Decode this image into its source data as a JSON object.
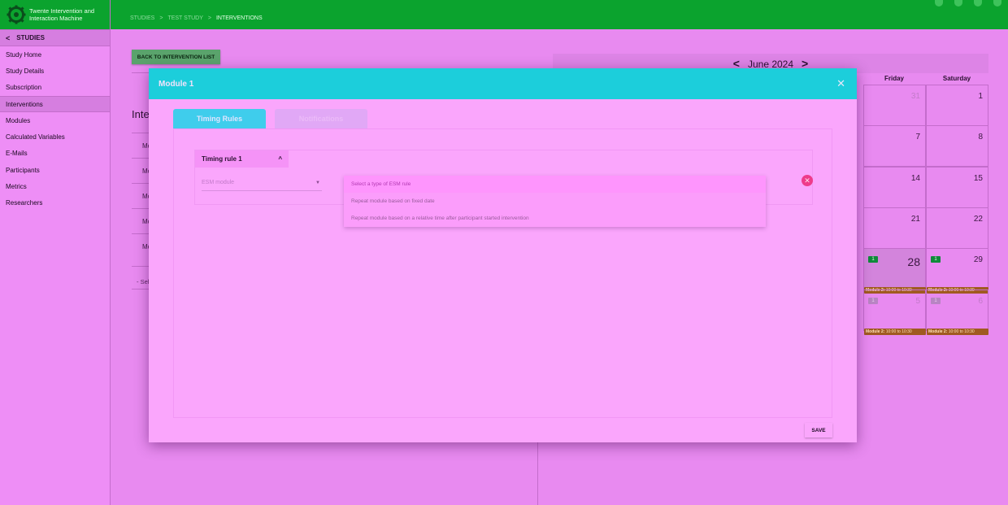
{
  "app": {
    "name": "Twente Intervention and Interaction Machine",
    "icon": "gear-logo"
  },
  "breadcrumbs": [
    "STUDIES",
    "TEST STUDY",
    "INTERVENTIONS"
  ],
  "breadcrumb_separator": ">",
  "top_icons": [
    "settings-icon",
    "shield-icon",
    "help-icon",
    "logout-icon"
  ],
  "sidebar": {
    "header": "STUDIES",
    "items": [
      {
        "label": "Study Home"
      },
      {
        "label": "Study Details"
      },
      {
        "label": "Subscription"
      },
      {
        "label": "Interventions",
        "active": true
      },
      {
        "label": "Modules"
      },
      {
        "label": "Calculated Variables"
      },
      {
        "label": "E-Mails"
      },
      {
        "label": "Participants"
      },
      {
        "label": "Metrics"
      },
      {
        "label": "Researchers"
      }
    ]
  },
  "page": {
    "back_button": "BACK TO INTERVENTION LIST",
    "panel_title": "Interv",
    "list_rows": [
      "Mo",
      "Mo",
      "Mo",
      "Mo",
      "Mo"
    ],
    "select_row": "- Sel"
  },
  "calendar": {
    "month": "June 2024",
    "prev": "<",
    "next": ">",
    "day_headers": [
      "Friday",
      "Saturday"
    ],
    "days": [
      "31",
      "1",
      "7",
      "8",
      "14",
      "15",
      "21",
      "22",
      "28",
      "29",
      "5",
      "6"
    ],
    "badges": [
      "1",
      "1",
      "1",
      "1"
    ],
    "event_label": "Module 2:",
    "event_time": "10:00 to 10:30"
  },
  "modal": {
    "title": "Module 1",
    "close": "✕",
    "tabs": [
      {
        "label": "Timing Rules",
        "active": true
      },
      {
        "label": "Notifications",
        "active": false
      }
    ],
    "rule": {
      "title": "Timing rule 1",
      "collapse": "^",
      "esm_module_placeholder": "ESM module",
      "type_placeholder": "Select a type of ESM rule",
      "options": [
        "Repeat module based on fixed date",
        "Repeat module based on a relative time after participant started intervention"
      ]
    },
    "save": "SAVE"
  },
  "colors": {
    "topbar": "#0ba32e",
    "modal_header": "#1ccedb",
    "remove": "#ee3b8a",
    "event": "#a05a22"
  }
}
